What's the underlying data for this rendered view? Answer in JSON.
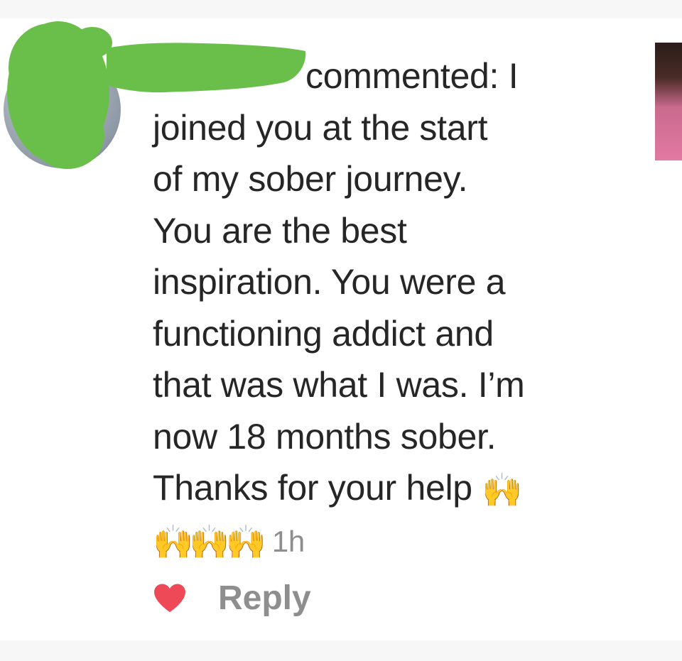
{
  "comment": {
    "verb_line": "commented: I",
    "lines": [
      "joined you at the start",
      "of my sober journey.",
      "You are the best",
      "inspiration. You were a",
      "functioning addict and",
      "that was what I was. I’m",
      "now 18 months sober.",
      "Thanks for your help"
    ],
    "trailing_emoji": "🙌",
    "emoji_row": "🙌🙌🙌",
    "time": "1h"
  },
  "actions": {
    "reply_label": "Reply",
    "liked": true,
    "heart_color": "#ed4956"
  },
  "icons": {
    "like": "heart-icon",
    "avatar": "avatar",
    "thumbnail": "post-thumbnail"
  },
  "colors": {
    "text": "#262626",
    "muted": "#8e8e8e",
    "redaction": "#6abf4b"
  }
}
